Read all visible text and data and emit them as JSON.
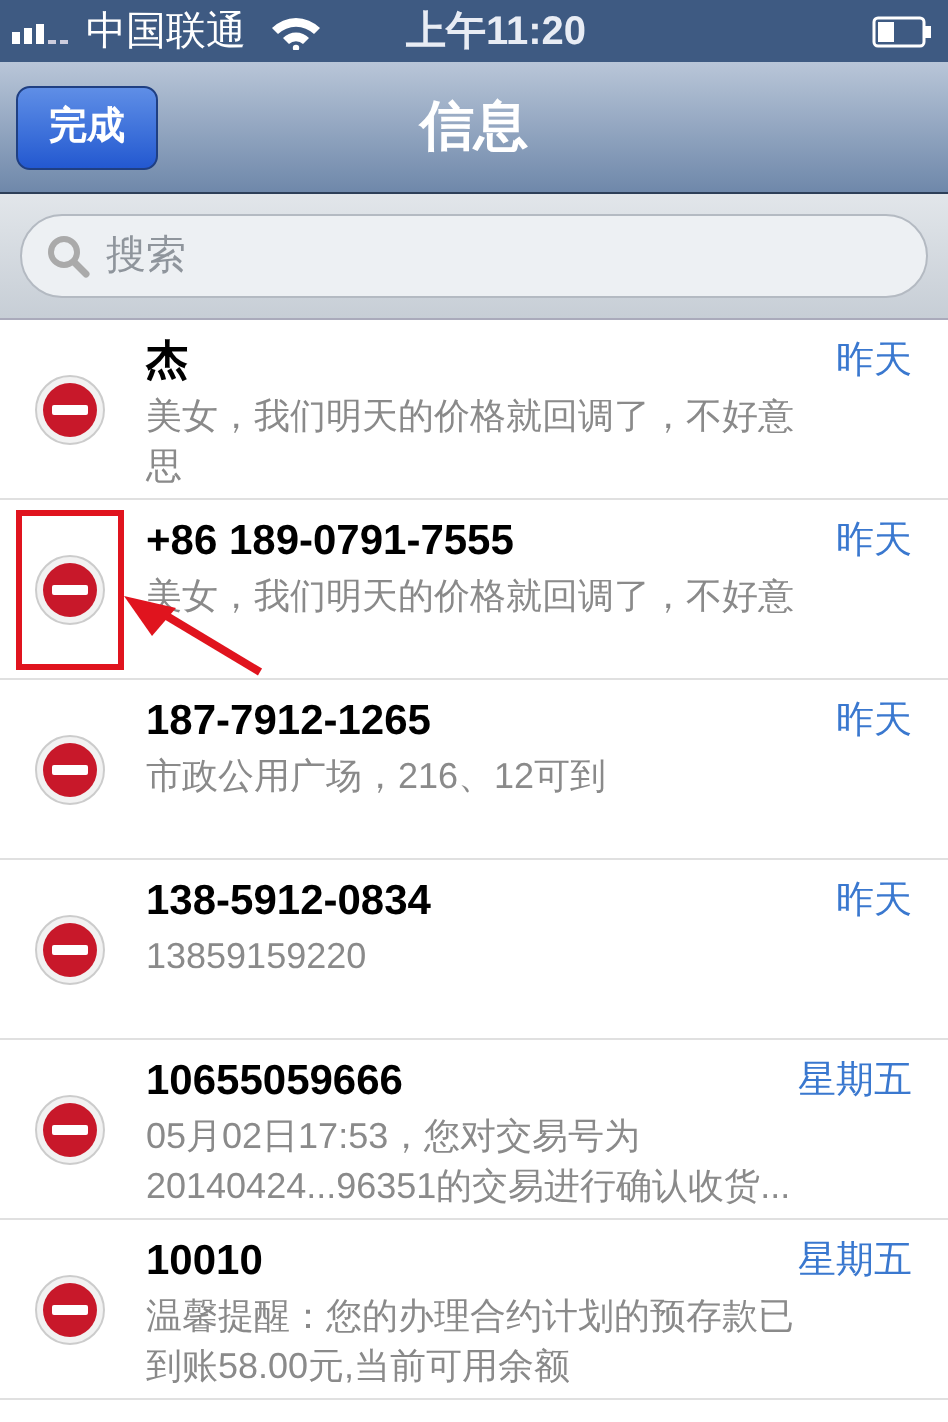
{
  "status_bar": {
    "carrier": "中国联通",
    "time": "上午11:20"
  },
  "nav_bar": {
    "done_button": "完成",
    "title": "信息"
  },
  "search": {
    "placeholder": "搜索"
  },
  "conversations": [
    {
      "sender": "杰",
      "date": "昨天",
      "preview": [
        "美女，我们明天的价格就回调了，不好意",
        "思"
      ],
      "highlighted": false
    },
    {
      "sender": "+86 189-0791-7555",
      "date": "昨天",
      "preview": [
        "美女，我们明天的价格就回调了，不好意"
      ],
      "highlighted": true
    },
    {
      "sender": "187-7912-1265",
      "date": "昨天",
      "preview": [
        "市政公用广场，216、12可到"
      ],
      "highlighted": false
    },
    {
      "sender": "138-5912-0834",
      "date": "昨天",
      "preview": [
        "13859159220"
      ],
      "highlighted": false
    },
    {
      "sender": "10655059666",
      "date": "星期五",
      "preview": [
        "05月02日17:53，您对交易号为",
        "20140424...96351的交易进行确认收货..."
      ],
      "highlighted": false
    },
    {
      "sender": "10010",
      "date": "星期五",
      "preview": [
        "温馨提醒：您的办理合约计划的预存款已",
        "到账58.00元,当前可用余额"
      ],
      "highlighted": false
    }
  ]
}
